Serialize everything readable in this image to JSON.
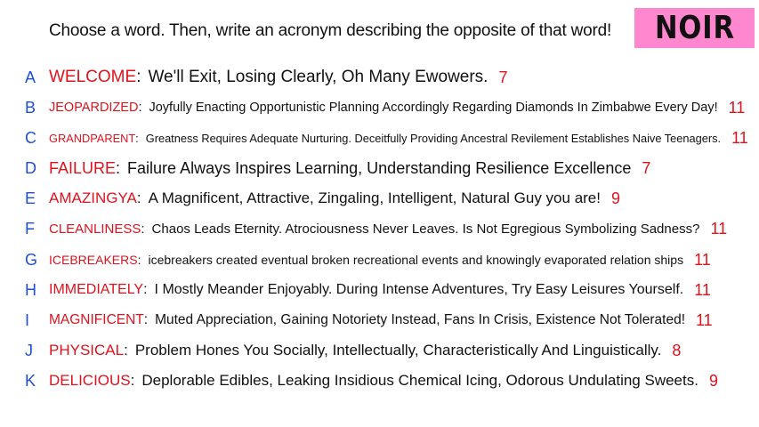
{
  "prompt": "Choose a word. Then, write an acronym describing the opposite of that word!",
  "badge": "NOIR",
  "rows": [
    {
      "letter": "A",
      "word": "WELCOME",
      "acronym": "We'll Exit, Losing Clearly, Oh Many Ewowers.",
      "count": "7"
    },
    {
      "letter": "B",
      "word": "JEOPARDIZED",
      "acronym": "Joyfully Enacting Opportunistic Planning Accordingly Regarding Diamonds In Zimbabwe Every Day!",
      "count": "11"
    },
    {
      "letter": "C",
      "word": "GRANDPARENT",
      "acronym": "Greatness Requires Adequate Nurturing. Deceitfully Providing Ancestral Revilement Establishes Naive Teenagers.",
      "count": "11"
    },
    {
      "letter": "D",
      "word": "FAILURE",
      "acronym": "Failure Always Inspires Learning, Understanding Resilience Excellence",
      "count": "7"
    },
    {
      "letter": "E",
      "word": "AMAZINGYA",
      "acronym": "A Magnificent, Attractive, Zingaling, Intelligent, Natural Guy you are!",
      "count": "9"
    },
    {
      "letter": "F",
      "word": "CLEANLINESS",
      "acronym": "Chaos Leads Eternity. Atrociousness Never Leaves. Is Not Egregious Symbolizing Sadness?",
      "count": "11"
    },
    {
      "letter": "G",
      "word": "ICEBREAKERS",
      "acronym": "icebreakers created eventual broken recreational events and knowingly evaporated relation ships",
      "count": "11"
    },
    {
      "letter": "H",
      "word": "IMMEDIATELY",
      "acronym": "I Mostly Meander Enjoyably. During Intense Adventures, Try Easy Leisures Yourself.",
      "count": "11"
    },
    {
      "letter": "I",
      "word": "MAGNIFICENT",
      "acronym": "Muted Appreciation, Gaining Notoriety Instead, Fans In Crisis, Existence Not Tolerated!",
      "count": "11"
    },
    {
      "letter": "J",
      "word": "PHYSICAL",
      "acronym": "Problem Hones You Socially, Intellectually, Characteristically And Linguistically.",
      "count": "8"
    },
    {
      "letter": "K",
      "word": "DELICIOUS",
      "acronym": "Deplorable Edibles, Leaking Insidious Chemical Icing, Odorous Undulating Sweets.",
      "count": "9"
    }
  ]
}
